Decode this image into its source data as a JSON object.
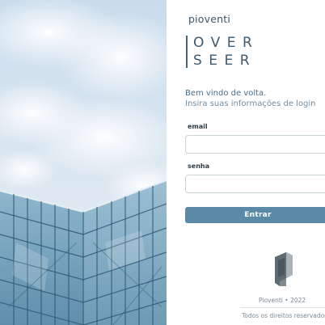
{
  "brand": {
    "company": "pioventi",
    "product_line1": "OVER",
    "product_line2": "SEER"
  },
  "login": {
    "welcome": "Bem vindo de volta.",
    "subtitle": "Insira suas informações de login",
    "email_label": "email",
    "email_value": "",
    "senha_label": "senha",
    "senha_value": "",
    "submit_label": "Entrar"
  },
  "footer": {
    "copyright": "Pioventi • 2022",
    "rights": "Todos os direitos reservados"
  },
  "colors": {
    "accent": "#5b8aa7",
    "brand_text": "#3d5a70",
    "welcome_text": "#4a6d87"
  },
  "icons": {
    "hero": "glass-building-photo",
    "logo": "pioventi-logo-icon"
  }
}
